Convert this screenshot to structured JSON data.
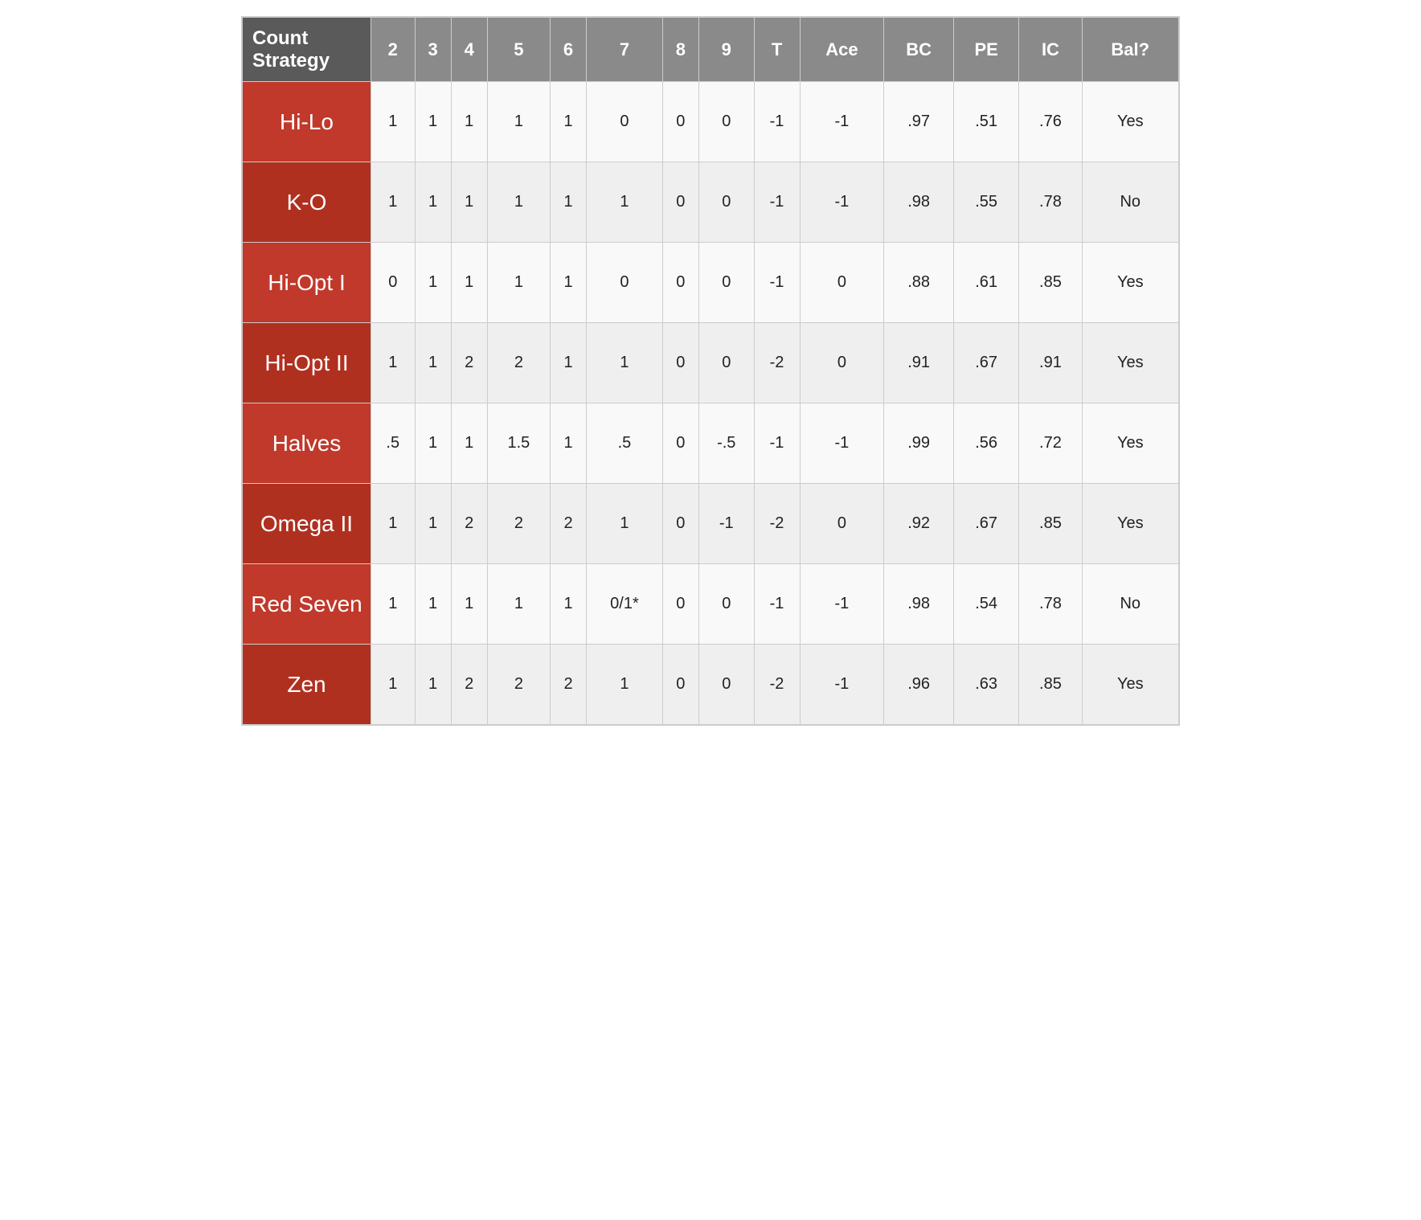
{
  "table": {
    "headers": {
      "first": "Count Strategy",
      "cols": [
        "2",
        "3",
        "4",
        "5",
        "6",
        "7",
        "8",
        "9",
        "T",
        "Ace",
        "BC",
        "PE",
        "IC",
        "Bal?"
      ]
    },
    "rows": [
      {
        "label": "Hi-Lo",
        "values": [
          "1",
          "1",
          "1",
          "1",
          "1",
          "0",
          "0",
          "0",
          "-1",
          "-1",
          ".97",
          ".51",
          ".76",
          "Yes"
        ]
      },
      {
        "label": "K-O",
        "values": [
          "1",
          "1",
          "1",
          "1",
          "1",
          "1",
          "0",
          "0",
          "-1",
          "-1",
          ".98",
          ".55",
          ".78",
          "No"
        ]
      },
      {
        "label": "Hi-Opt I",
        "values": [
          "0",
          "1",
          "1",
          "1",
          "1",
          "0",
          "0",
          "0",
          "-1",
          "0",
          ".88",
          ".61",
          ".85",
          "Yes"
        ]
      },
      {
        "label": "Hi-Opt II",
        "values": [
          "1",
          "1",
          "2",
          "2",
          "1",
          "1",
          "0",
          "0",
          "-2",
          "0",
          ".91",
          ".67",
          ".91",
          "Yes"
        ]
      },
      {
        "label": "Halves",
        "values": [
          ".5",
          "1",
          "1",
          "1.5",
          "1",
          ".5",
          "0",
          "-.5",
          "-1",
          "-1",
          ".99",
          ".56",
          ".72",
          "Yes"
        ]
      },
      {
        "label": "Omega II",
        "values": [
          "1",
          "1",
          "2",
          "2",
          "2",
          "1",
          "0",
          "-1",
          "-2",
          "0",
          ".92",
          ".67",
          ".85",
          "Yes"
        ]
      },
      {
        "label": "Red Seven",
        "values": [
          "1",
          "1",
          "1",
          "1",
          "1",
          "0/1*",
          "0",
          "0",
          "-1",
          "-1",
          ".98",
          ".54",
          ".78",
          "No"
        ]
      },
      {
        "label": "Zen",
        "values": [
          "1",
          "1",
          "2",
          "2",
          "2",
          "1",
          "0",
          "0",
          "-2",
          "-1",
          ".96",
          ".63",
          ".85",
          "Yes"
        ]
      }
    ]
  }
}
